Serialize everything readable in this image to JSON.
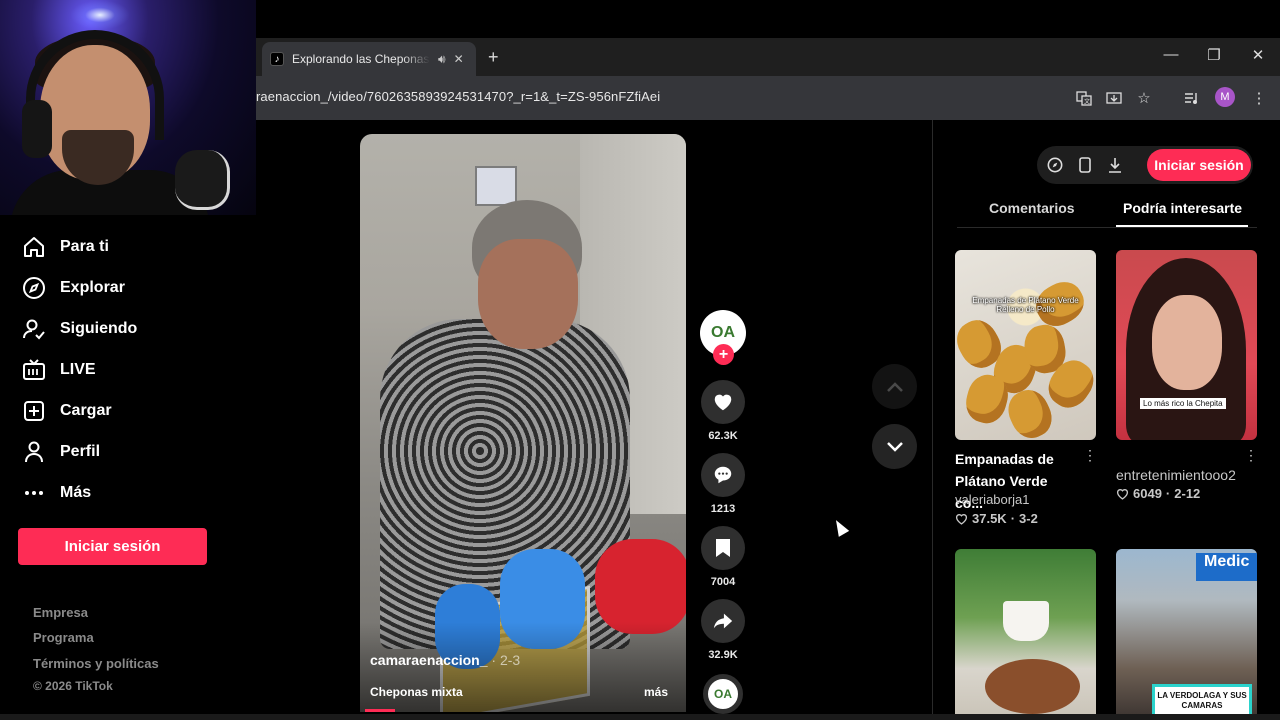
{
  "browser": {
    "tab_title": "Explorando las Cheponas M",
    "new_tab": "+",
    "url": "raenaccion_/video/7602635893924531470?_r=1&_t=ZS-956nFZfiAei",
    "profile_initial": "M",
    "window_controls": {
      "minimize": "—",
      "restore": "❐",
      "close": "✕"
    }
  },
  "sidebar": {
    "items": [
      {
        "label": "Para ti",
        "icon": "home-icon"
      },
      {
        "label": "Explorar",
        "icon": "compass-icon"
      },
      {
        "label": "Siguiendo",
        "icon": "following-icon"
      },
      {
        "label": "LIVE",
        "icon": "live-tv-icon"
      },
      {
        "label": "Cargar",
        "icon": "upload-icon"
      },
      {
        "label": "Perfil",
        "icon": "profile-icon"
      },
      {
        "label": "Más",
        "icon": "more-dots-icon"
      }
    ],
    "login_label": "Iniciar sesión",
    "footer_links": [
      "Empresa",
      "Programa",
      "Términos y políticas"
    ],
    "copyright": "© 2026 TikTok"
  },
  "video": {
    "username": "camaraenaccion_",
    "username_suffix": " · 2-3",
    "caption": "Cheponas mixta",
    "more": "más",
    "creator_avatar_text": "OA"
  },
  "actions": {
    "likes": "62.3K",
    "comments": "1213",
    "saves": "7004",
    "shares": "32.9K"
  },
  "right_panel": {
    "login_label": "Iniciar sesión",
    "tabs": [
      "Comentarios",
      "Podría interesarte"
    ],
    "active_tab": "Podría interesarte",
    "cards": [
      {
        "thumb_caption": "Empanadas de Plátano Verde Relleno de Pollo",
        "title": "Empanadas de Plátano Verde co...",
        "user": "valeriaborja1",
        "likes": "37.5K",
        "date": "3-2"
      },
      {
        "thumb_caption": "Lo más rico la Chepita",
        "title": "",
        "user": "entretenimientooo2",
        "likes": "6049",
        "date": "2-12"
      },
      {
        "thumb_caption": ""
      },
      {
        "thumb_sign": "Medic",
        "thumb_badge": "LA VERDOLAGA Y SUS CAMARAS"
      }
    ]
  },
  "colors": {
    "accent": "#fe2c55",
    "background": "#000000",
    "chrome": "#35363a"
  }
}
